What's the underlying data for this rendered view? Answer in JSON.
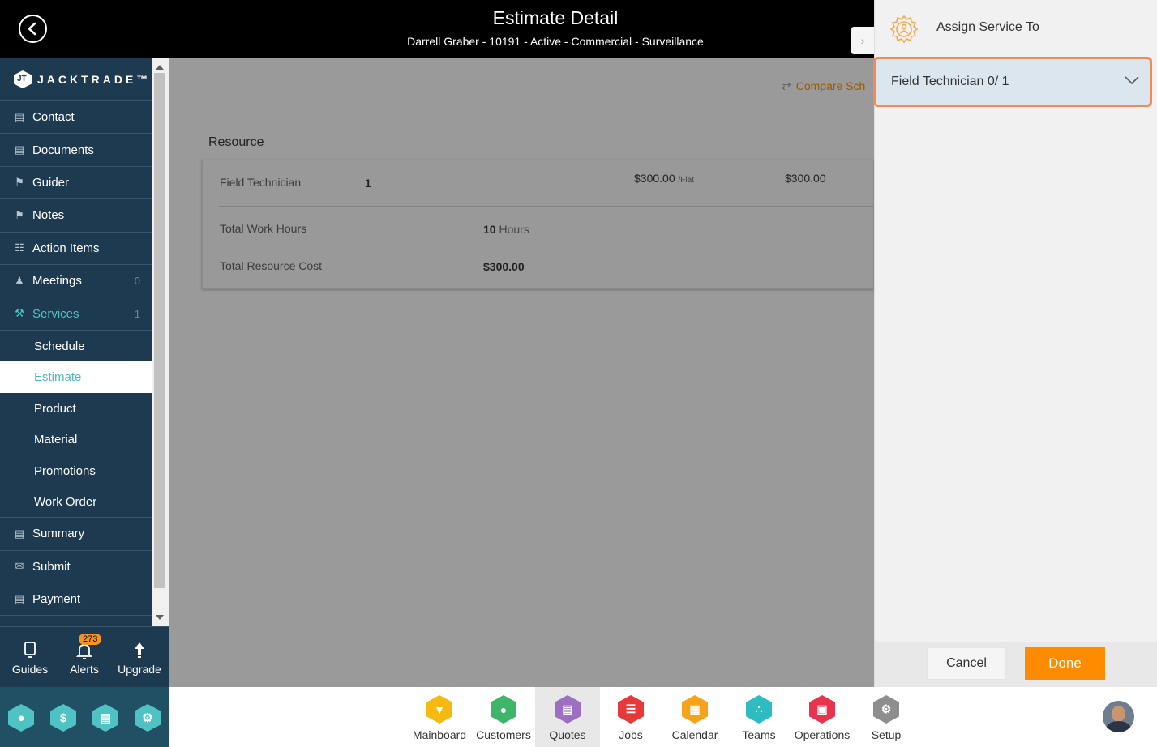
{
  "header": {
    "title": "Estimate Detail",
    "subtitle": "Darrell Graber - 10191 - Active - Commercial - Surveillance"
  },
  "sidebar": {
    "logo_text": "JACKTRADE™",
    "items": [
      {
        "label": "Contact",
        "icon": "contact-book-icon"
      },
      {
        "label": "Documents",
        "icon": "documents-icon"
      },
      {
        "label": "Guider",
        "icon": "signpost-icon"
      },
      {
        "label": "Notes",
        "icon": "signpost-icon"
      },
      {
        "label": "Action Items",
        "icon": "clipboard-icon"
      },
      {
        "label": "Meetings",
        "icon": "meetings-icon",
        "count": "0"
      },
      {
        "label": "Services",
        "icon": "services-icon",
        "count": "1"
      }
    ],
    "sub_items": [
      "Schedule",
      "Estimate",
      "Product",
      "Material",
      "Promotions",
      "Work Order"
    ],
    "items_after": [
      {
        "label": "Summary",
        "icon": "summary-icon"
      },
      {
        "label": "Submit",
        "icon": "submit-icon"
      },
      {
        "label": "Payment",
        "icon": "payment-icon"
      }
    ],
    "selected": "Estimate"
  },
  "bottom_left": {
    "guides": "Guides",
    "alerts": "Alerts",
    "alerts_badge": "273",
    "upgrade": "Upgrade"
  },
  "main": {
    "compare_link": "Compare Sch",
    "section_title": "Resource",
    "resource_row": {
      "name": "Field Technician",
      "qty": "1",
      "rate": "$300.00",
      "rate_unit": "/Flat",
      "total": "$300.00"
    },
    "total_work_hours_label": "Total Work Hours",
    "total_work_hours_value": "10",
    "total_work_hours_unit": "Hours",
    "total_resource_cost_label": "Total Resource Cost",
    "total_resource_cost_value": "$300.00"
  },
  "panel": {
    "title": "Assign Service To",
    "dropdown_label": "Field Technician 0/ 1",
    "cancel": "Cancel",
    "done": "Done"
  },
  "appbar": {
    "apps": [
      {
        "label": "Mainboard",
        "color": "#f5b90f"
      },
      {
        "label": "Customers",
        "color": "#3fb56a"
      },
      {
        "label": "Quotes",
        "color": "#9d6fc2"
      },
      {
        "label": "Jobs",
        "color": "#e8393a"
      },
      {
        "label": "Calendar",
        "color": "#f7a21b"
      },
      {
        "label": "Teams",
        "color": "#2fbcc0"
      },
      {
        "label": "Operations",
        "color": "#e8334f"
      },
      {
        "label": "Setup",
        "color": "#8e8e8e"
      }
    ],
    "active": "Quotes"
  },
  "colors": {
    "sidebar_bg": "#1e3a50",
    "accent_teal": "#4fc3c3",
    "done_orange": "#ff8c00",
    "dropdown_border": "#f28a54"
  }
}
